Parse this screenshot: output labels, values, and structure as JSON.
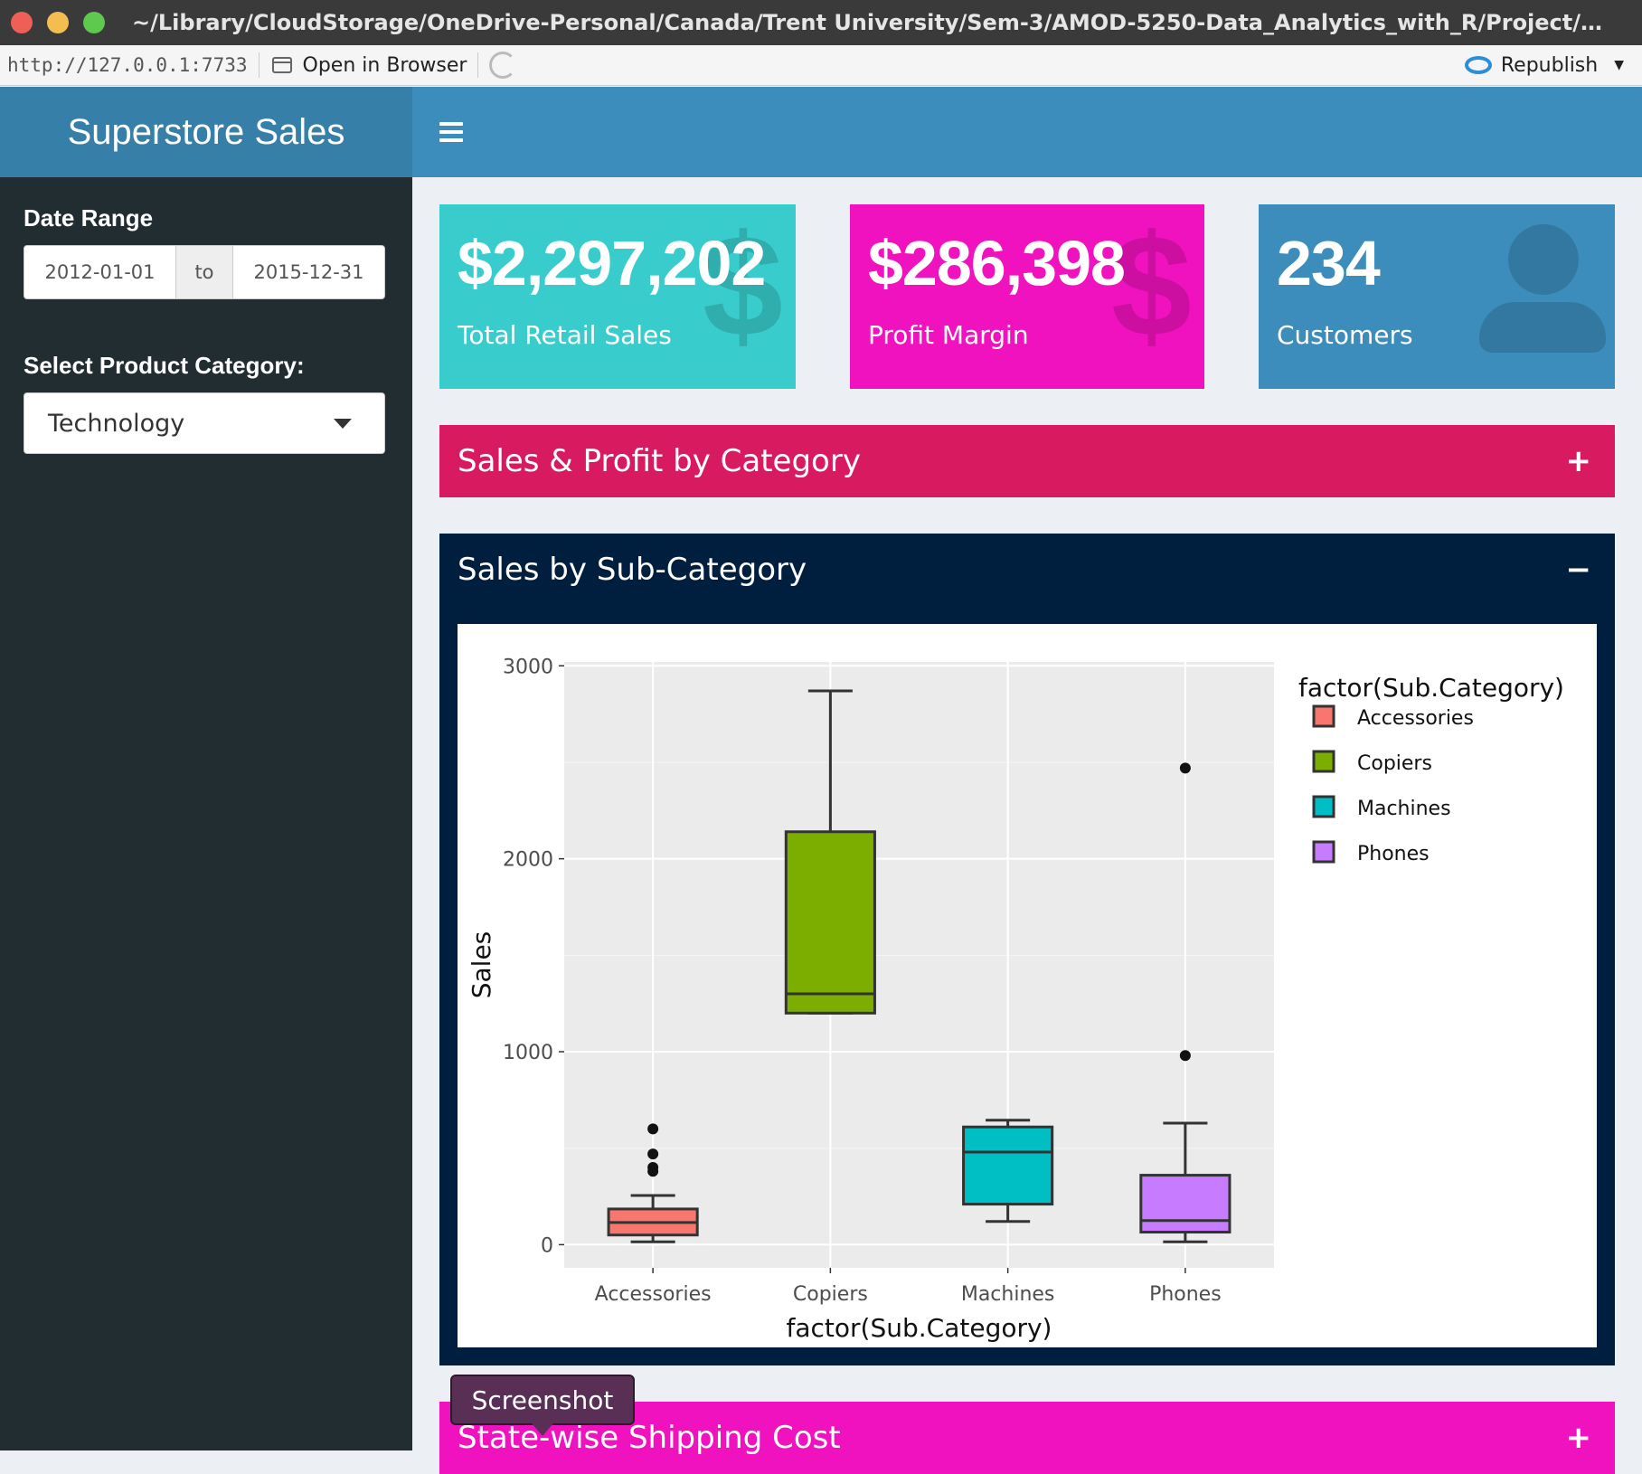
{
  "window": {
    "title": "~/Library/CloudStorage/OneDrive-Personal/Canada/Trent University/Sem-3/AMOD-5250-Data_Analytics_with_R/Project/supersto..."
  },
  "toolbar": {
    "url": "http://127.0.0.1:7733",
    "open_browser": "Open in Browser",
    "republish": "Republish"
  },
  "header": {
    "title": "Superstore Sales"
  },
  "sidebar": {
    "date_label": "Date Range",
    "date_start": "2012-01-01",
    "date_sep": "to",
    "date_end": "2015-12-31",
    "category_label": "Select Product Category:",
    "category_value": "Technology"
  },
  "value_boxes": [
    {
      "value": "$2,297,202",
      "subtitle": "Total Retail Sales",
      "icon": "dollar-icon",
      "color": "#39cccc"
    },
    {
      "value": "$286,398",
      "subtitle": "Profit Margin",
      "icon": "dollar-icon",
      "color": "#f012be"
    },
    {
      "value": "234",
      "subtitle": "Customers",
      "icon": "user-icon",
      "color": "#3c8dbc"
    }
  ],
  "boxes": {
    "sales_profit": {
      "title": "Sales & Profit by Category",
      "tool": "+",
      "color": "#d81b60"
    },
    "sub_category": {
      "title": "Sales by Sub-Category",
      "tool": "−",
      "color": "#001f3f"
    },
    "shipping": {
      "title": "State-wise Shipping Cost",
      "tool": "+",
      "color": "#f012be"
    }
  },
  "tooltip": {
    "text": "Screenshot"
  },
  "chart_data": {
    "type": "boxplot",
    "xlabel": "factor(Sub.Category)",
    "ylabel": "Sales",
    "legend_title": "factor(Sub.Category)",
    "legend_position": "right",
    "ylim": [
      -120,
      3020
    ],
    "yticks": [
      0,
      1000,
      2000,
      3000
    ],
    "grid": true,
    "categories": [
      "Accessories",
      "Copiers",
      "Machines",
      "Phones"
    ],
    "colors": [
      "#f8766d",
      "#7cae00",
      "#00bfc4",
      "#c77cff"
    ],
    "boxes": [
      {
        "name": "Accessories",
        "min": 15,
        "q1": 50,
        "median": 115,
        "q3": 185,
        "max": 255,
        "outliers": [
          380,
          400,
          470,
          600
        ]
      },
      {
        "name": "Copiers",
        "min": 1200,
        "q1": 1200,
        "median": 1300,
        "q3": 2140,
        "max": 2870,
        "outliers": []
      },
      {
        "name": "Machines",
        "min": 120,
        "q1": 210,
        "median": 480,
        "q3": 610,
        "max": 645,
        "outliers": []
      },
      {
        "name": "Phones",
        "min": 15,
        "q1": 65,
        "median": 125,
        "q3": 360,
        "max": 630,
        "outliers": [
          980,
          2470
        ]
      }
    ]
  }
}
